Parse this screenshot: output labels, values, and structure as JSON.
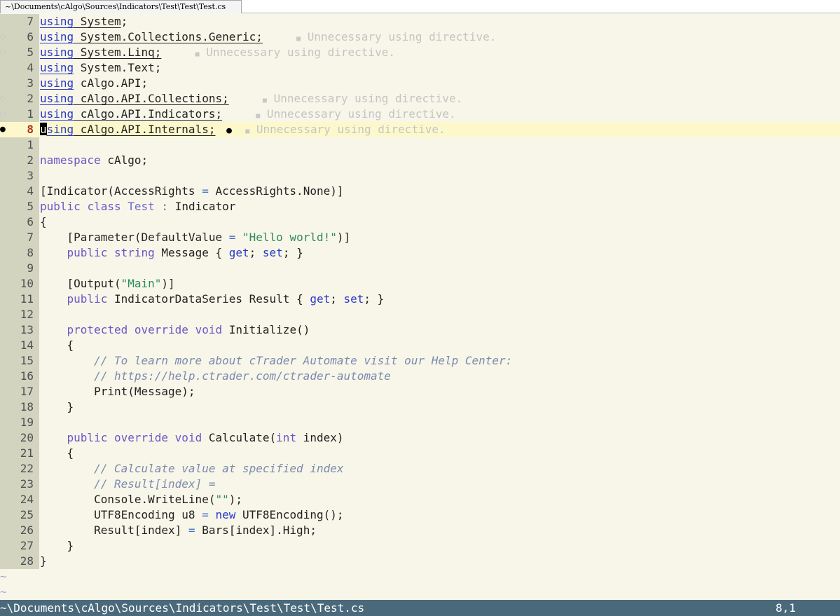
{
  "tab": {
    "label": "~\\Documents\\cAlgo\\Sources\\Indicators\\Test\\Test\\Test.cs"
  },
  "hint_text": "Unnecessary using directive.",
  "lines": [
    {
      "num": "7",
      "sign": "",
      "current": false,
      "tokens": [
        [
          "kw-blue ul",
          "using"
        ],
        [
          "ul",
          " System"
        ],
        [
          "",
          ";"
        ]
      ]
    },
    {
      "num": "6",
      "sign": "bulb",
      "current": false,
      "tokens": [
        [
          "kw-blue ul",
          "using"
        ],
        [
          "ul",
          " System.Collections.Generic;"
        ]
      ],
      "hint": true
    },
    {
      "num": "5",
      "sign": "bulb",
      "current": false,
      "tokens": [
        [
          "kw-blue ul",
          "using"
        ],
        [
          "ul",
          " System.Linq;"
        ]
      ],
      "hint": true
    },
    {
      "num": "4",
      "sign": "",
      "current": false,
      "tokens": [
        [
          "kw-blue ul",
          "using"
        ],
        [
          "",
          " System.Text;"
        ]
      ]
    },
    {
      "num": "3",
      "sign": "",
      "current": false,
      "tokens": [
        [
          "kw-blue ul",
          "using"
        ],
        [
          "",
          " cAlgo.API;"
        ]
      ]
    },
    {
      "num": "2",
      "sign": "bulb",
      "current": false,
      "tokens": [
        [
          "kw-blue ul",
          "using"
        ],
        [
          "ul",
          " cAlgo.API.Collections;"
        ]
      ],
      "hint": true
    },
    {
      "num": "1",
      "sign": "bulb",
      "current": false,
      "tokens": [
        [
          "kw-blue ul",
          "using"
        ],
        [
          "ul",
          " cAlgo.API.Indicators;"
        ]
      ],
      "hint": true
    },
    {
      "num": "8",
      "sign": "bulb-dark",
      "current": true,
      "tokens": [
        [
          "cursor ul",
          "u"
        ],
        [
          "kw-blue ul",
          "sing"
        ],
        [
          "ul",
          " cAlgo.API.Internals;"
        ]
      ],
      "hint": true,
      "inline_bulb": true
    },
    {
      "num": "1",
      "sign": "",
      "current": false,
      "tokens": []
    },
    {
      "num": "2",
      "sign": "",
      "current": false,
      "tokens": [
        [
          "kw",
          "namespace"
        ],
        [
          "",
          " cAlgo;"
        ]
      ]
    },
    {
      "num": "3",
      "sign": "",
      "current": false,
      "tokens": []
    },
    {
      "num": "4",
      "sign": "",
      "current": false,
      "tokens": [
        [
          "",
          "[Indicator(AccessRights "
        ],
        [
          "op",
          "="
        ],
        [
          "",
          " AccessRights.None)]"
        ]
      ]
    },
    {
      "num": "5",
      "sign": "",
      "current": false,
      "tokens": [
        [
          "kw",
          "public"
        ],
        [
          "",
          " "
        ],
        [
          "kw",
          "class"
        ],
        [
          "",
          " "
        ],
        [
          "type",
          "Test"
        ],
        [
          "",
          " "
        ],
        [
          "op",
          ":"
        ],
        [
          "",
          " Indicator"
        ]
      ]
    },
    {
      "num": "6",
      "sign": "",
      "current": false,
      "tokens": [
        [
          "",
          "{"
        ]
      ]
    },
    {
      "num": "7",
      "sign": "",
      "current": false,
      "tokens": [
        [
          "",
          "    [Parameter(DefaultValue "
        ],
        [
          "op",
          "="
        ],
        [
          "",
          " "
        ],
        [
          "str",
          "\"Hello world!\""
        ],
        [
          "",
          ")]"
        ]
      ]
    },
    {
      "num": "8",
      "sign": "",
      "current": false,
      "tokens": [
        [
          "",
          "    "
        ],
        [
          "kw",
          "public"
        ],
        [
          "",
          " "
        ],
        [
          "kw",
          "string"
        ],
        [
          "",
          " Message { "
        ],
        [
          "kw-blue",
          "get"
        ],
        [
          "",
          "; "
        ],
        [
          "kw-blue",
          "set"
        ],
        [
          "",
          "; }"
        ]
      ]
    },
    {
      "num": "9",
      "sign": "",
      "current": false,
      "tokens": []
    },
    {
      "num": "10",
      "sign": "",
      "current": false,
      "tokens": [
        [
          "",
          "    [Output("
        ],
        [
          "str",
          "\"Main\""
        ],
        [
          "",
          ")]"
        ]
      ]
    },
    {
      "num": "11",
      "sign": "",
      "current": false,
      "tokens": [
        [
          "",
          "    "
        ],
        [
          "kw",
          "public"
        ],
        [
          "",
          " IndicatorDataSeries Result { "
        ],
        [
          "kw-blue",
          "get"
        ],
        [
          "",
          "; "
        ],
        [
          "kw-blue",
          "set"
        ],
        [
          "",
          "; }"
        ]
      ]
    },
    {
      "num": "12",
      "sign": "",
      "current": false,
      "tokens": []
    },
    {
      "num": "13",
      "sign": "",
      "current": false,
      "tokens": [
        [
          "",
          "    "
        ],
        [
          "kw",
          "protected"
        ],
        [
          "",
          " "
        ],
        [
          "kw",
          "override"
        ],
        [
          "",
          " "
        ],
        [
          "kw",
          "void"
        ],
        [
          "",
          " Initialize()"
        ]
      ]
    },
    {
      "num": "14",
      "sign": "",
      "current": false,
      "tokens": [
        [
          "",
          "    {"
        ]
      ]
    },
    {
      "num": "15",
      "sign": "",
      "current": false,
      "tokens": [
        [
          "",
          "        "
        ],
        [
          "cmt",
          "// To learn more about cTrader Automate visit our Help Center:"
        ]
      ]
    },
    {
      "num": "16",
      "sign": "",
      "current": false,
      "tokens": [
        [
          "",
          "        "
        ],
        [
          "cmt",
          "// https://help.ctrader.com/ctrader-automate"
        ]
      ]
    },
    {
      "num": "17",
      "sign": "",
      "current": false,
      "tokens": [
        [
          "",
          "        Print(Message);"
        ]
      ]
    },
    {
      "num": "18",
      "sign": "",
      "current": false,
      "tokens": [
        [
          "",
          "    }"
        ]
      ]
    },
    {
      "num": "19",
      "sign": "",
      "current": false,
      "tokens": []
    },
    {
      "num": "20",
      "sign": "",
      "current": false,
      "tokens": [
        [
          "",
          "    "
        ],
        [
          "kw",
          "public"
        ],
        [
          "",
          " "
        ],
        [
          "kw",
          "override"
        ],
        [
          "",
          " "
        ],
        [
          "kw",
          "void"
        ],
        [
          "",
          " Calculate("
        ],
        [
          "kw",
          "int"
        ],
        [
          "",
          " index)"
        ]
      ]
    },
    {
      "num": "21",
      "sign": "",
      "current": false,
      "tokens": [
        [
          "",
          "    {"
        ]
      ]
    },
    {
      "num": "22",
      "sign": "",
      "current": false,
      "tokens": [
        [
          "",
          "        "
        ],
        [
          "cmt",
          "// Calculate value at specified index"
        ]
      ]
    },
    {
      "num": "23",
      "sign": "",
      "current": false,
      "tokens": [
        [
          "",
          "        "
        ],
        [
          "cmt",
          "// Result[index] ="
        ]
      ]
    },
    {
      "num": "24",
      "sign": "",
      "current": false,
      "tokens": [
        [
          "",
          "        Console.WriteLine("
        ],
        [
          "str",
          "\"\""
        ],
        [
          "",
          ");"
        ]
      ]
    },
    {
      "num": "25",
      "sign": "",
      "current": false,
      "tokens": [
        [
          "",
          "        UTF8Encoding u8 "
        ],
        [
          "op",
          "="
        ],
        [
          "",
          " "
        ],
        [
          "kw-blue",
          "new"
        ],
        [
          "",
          " UTF8Encoding();"
        ]
      ]
    },
    {
      "num": "26",
      "sign": "",
      "current": false,
      "tokens": [
        [
          "",
          "        Result[index] "
        ],
        [
          "op",
          "="
        ],
        [
          "",
          " Bars[index].High;"
        ]
      ]
    },
    {
      "num": "27",
      "sign": "",
      "current": false,
      "tokens": [
        [
          "",
          "    }"
        ]
      ]
    },
    {
      "num": "28",
      "sign": "",
      "current": false,
      "tokens": [
        [
          "",
          "}"
        ]
      ]
    }
  ],
  "tilde_rows": [
    "~",
    "~"
  ],
  "status": {
    "path": "~\\Documents\\cAlgo\\Sources\\Indicators\\Test\\Test\\Test.cs",
    "position": "8,1"
  },
  "colors": {
    "background": "#f8f6e8",
    "gutter": "#d2d4c0",
    "current_line": "#fdf8cc",
    "statusbar": "#4a6a7c",
    "keyword": "#6b56c8",
    "string": "#2e8a5e",
    "comment": "#7a8ab0"
  }
}
